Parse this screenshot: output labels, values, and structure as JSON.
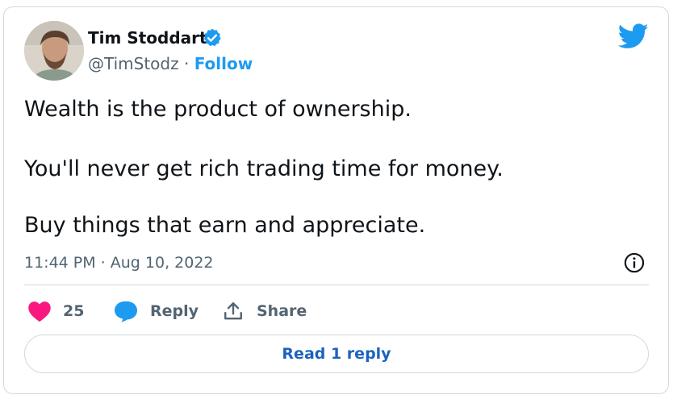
{
  "author": {
    "name": "Tim Stoddart",
    "handle": "@TimStodz",
    "separator": " · ",
    "follow_label": "Follow"
  },
  "tweet": {
    "lines": [
      "Wealth is the product of ownership.",
      "You'll never get rich trading time for money.",
      "Buy things that earn and appreciate."
    ],
    "timestamp": "11:44 PM · Aug 10, 2022"
  },
  "actions": {
    "like_count": "25",
    "reply_label": "Reply",
    "share_label": "Share"
  },
  "read_replies_label": "Read 1 reply",
  "icons": {
    "avatar": "avatar",
    "verified": "verified-badge-icon",
    "brand": "twitter-bird-icon",
    "info": "info-icon",
    "like": "heart-icon",
    "reply": "speech-bubble-icon",
    "share": "share-icon"
  },
  "colors": {
    "twitter_blue": "#1d9bf0",
    "like_pink": "#f91880",
    "text_primary": "#0f1419",
    "text_secondary": "#536471",
    "border": "#cfd9de",
    "read_reply_text": "#1d62bd"
  }
}
